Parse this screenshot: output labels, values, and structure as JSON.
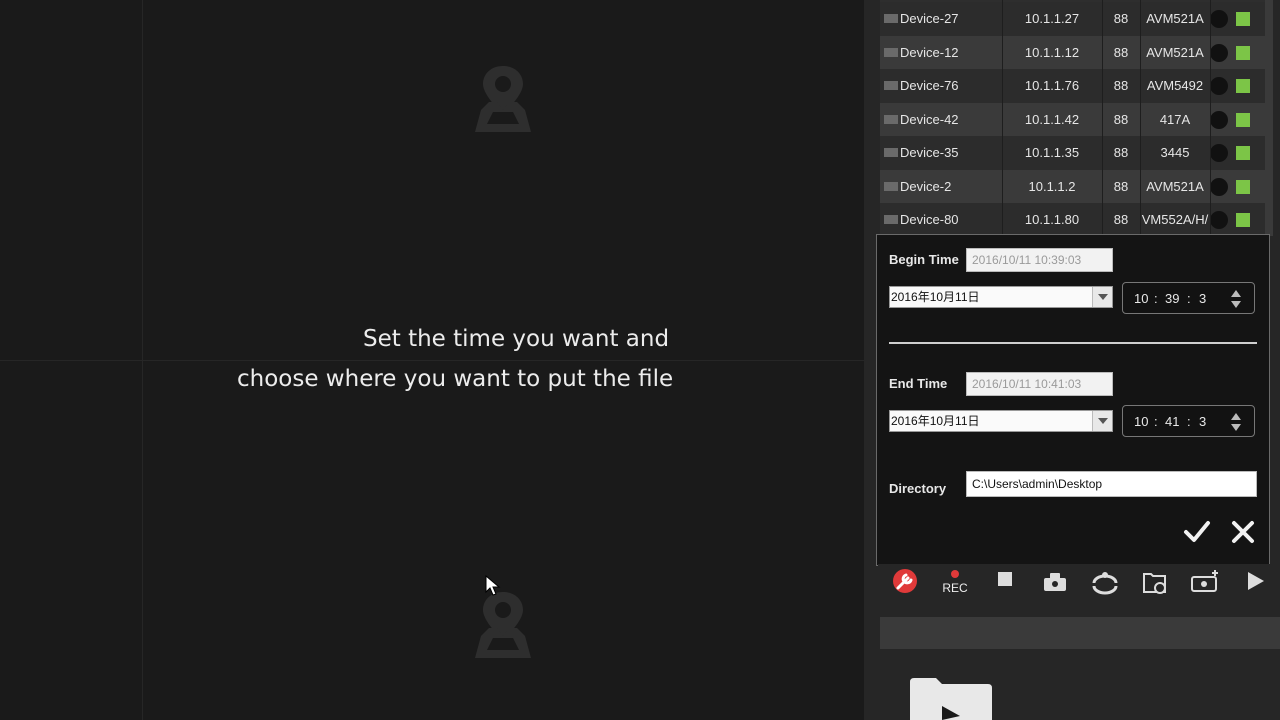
{
  "caption": {
    "line1": "Set the time you want and",
    "line2": "choose where you want to put the file"
  },
  "devices": [
    {
      "name": "Device-27",
      "ip": "10.1.1.27",
      "port": "88",
      "model": "AVM521A"
    },
    {
      "name": "Device-12",
      "ip": "10.1.1.12",
      "port": "88",
      "model": "AVM521A"
    },
    {
      "name": "Device-76",
      "ip": "10.1.1.76",
      "port": "88",
      "model": "AVM5492"
    },
    {
      "name": "Device-42",
      "ip": "10.1.1.42",
      "port": "88",
      "model": "417A"
    },
    {
      "name": "Device-35",
      "ip": "10.1.1.35",
      "port": "88",
      "model": "3445"
    },
    {
      "name": "Device-2",
      "ip": "10.1.1.2",
      "port": "88",
      "model": "AVM521A"
    },
    {
      "name": "Device-80",
      "ip": "10.1.1.80",
      "port": "88",
      "model": "VM552A/H/"
    }
  ],
  "dialog": {
    "begin_label": "Begin Time",
    "begin_value": "2016/10/11 10:39:03",
    "begin_date": "2016年10月11日",
    "begin_h": "10",
    "begin_m": "39",
    "begin_s": "3",
    "end_label": "End Time",
    "end_value": "2016/10/11 10:41:03",
    "end_date": "2016年10月11日",
    "end_h": "10",
    "end_m": "41",
    "end_s": "3",
    "sep": ":",
    "dir_label": "Directory",
    "dir_value": "C:\\Users\\admin\\Desktop"
  },
  "toolbar": {
    "rec_label": "REC"
  },
  "colors": {
    "status_online": "#7cc547",
    "record_red": "#e03a3a"
  }
}
